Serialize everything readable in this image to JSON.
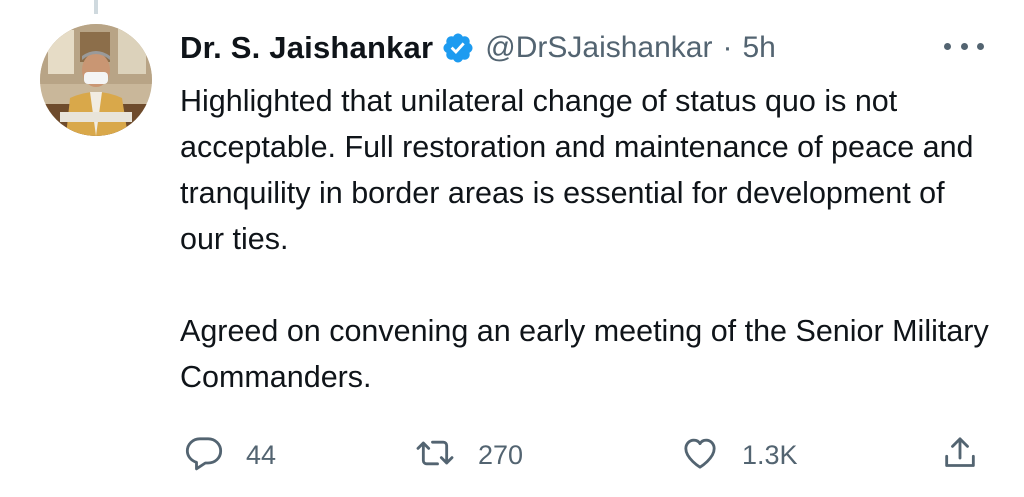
{
  "author": {
    "display_name": "Dr. S. Jaishankar",
    "handle": "@DrSJaishankar",
    "separator": "·",
    "timestamp": "5h",
    "verified": true
  },
  "tweet": {
    "paragraphs": [
      "Highlighted that unilateral change of status quo is not acceptable. Full restoration and maintenance of peace and tranquility in border areas is essential for development of our ties.",
      "Agreed on convening  an early meeting of the Senior Military Commanders."
    ]
  },
  "actions": {
    "reply": {
      "icon": "reply-icon",
      "count": "44"
    },
    "retweet": {
      "icon": "retweet-icon",
      "count": "270"
    },
    "like": {
      "icon": "heart-icon",
      "count": "1.3K"
    },
    "share": {
      "icon": "share-icon"
    }
  },
  "colors": {
    "text": "#0f1419",
    "secondary": "#536471",
    "verified_badge": "#1d9bf0",
    "thread_line": "#cfd9de"
  }
}
